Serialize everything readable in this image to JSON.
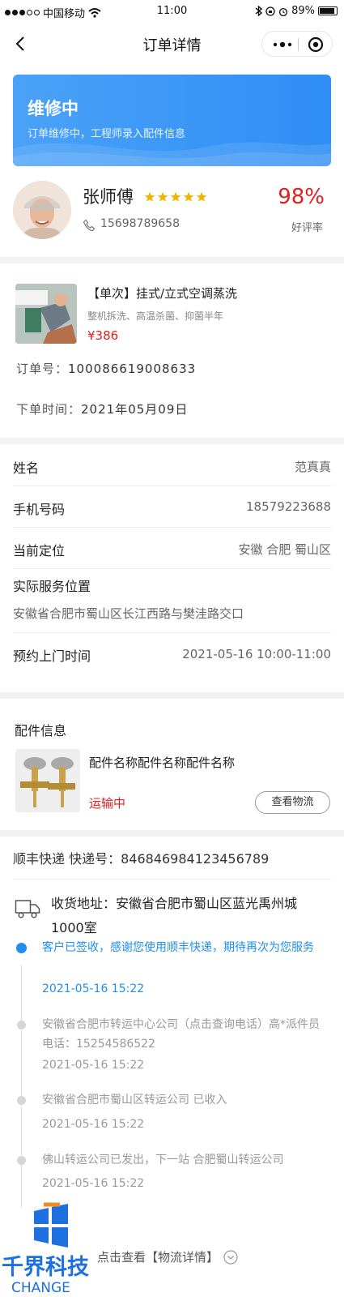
{
  "status_bar": {
    "carrier": "中国移动",
    "time": "11:00",
    "battery": "89%"
  },
  "nav": {
    "title": "订单详情",
    "more_icon": "more-dots-icon",
    "target_icon": "target-icon",
    "back_icon": "back-chevron-icon"
  },
  "banner": {
    "title": "维修中",
    "desc": "订单维修中，工程师录入配件信息",
    "colors": {
      "start": "#4aa2f8",
      "end": "#2f8ef5"
    }
  },
  "master": {
    "name": "张师傅",
    "stars": 5,
    "phone": "15698789658",
    "rate": "98%",
    "rate_label": "好评率"
  },
  "order": {
    "name": "【单次】挂式/立式空调蒸洗",
    "sub": "整机拆洗、高温杀菌、抑菌半年",
    "price": "¥386",
    "no_label": "订单号：",
    "no_value": "100086619008633",
    "time_label": "下单时间：",
    "time_value": "2021年05月09日"
  },
  "customer": {
    "name_label": "姓名",
    "name_value": "范真真",
    "phone_label": "手机号码",
    "phone_value": "18579223688",
    "location_label": "当前定位",
    "location_value": "安徽 合肥 蜀山区",
    "address_label": "实际服务位置",
    "address_value": "安徽省合肥市蜀山区长江西路与樊洼路交口",
    "appt_label": "预约上门时间",
    "appt_value": "2021-05-16 10:00-11:00"
  },
  "parts": {
    "title": "配件信息",
    "name": "配件名称配件名称配件名称",
    "status": "运输中",
    "button": "查看物流"
  },
  "shipping": {
    "header": "顺丰快递  快递号：846846984123456789",
    "receive": "收货地址：安徽省合肥市蜀山区蓝光禹州城1000室",
    "timeline": [
      {
        "text": "客户已签收，感谢您使用顺丰快递，期待再次为您服务",
        "time": "2021-05-16 15:22",
        "active": true
      },
      {
        "text": "安徽省合肥市转运中心公司（点击查询电话）高*派件员电话：15254586522",
        "time": "2021-05-16 15:22",
        "active": false
      },
      {
        "text": "安徽省合肥市蜀山区转运公司 已收入",
        "time": "2021-05-16 15:22",
        "active": false
      },
      {
        "text": "佛山转运公司已发出，下一站 合肥蜀山转运公司",
        "time": "2021-05-16 15:22",
        "active": false
      }
    ],
    "more": "点击查看【物流详情】"
  },
  "watermark": {
    "brand": "千界科技",
    "sub": "CHANGE"
  },
  "colors": {
    "accent_blue": "#1e8ef0",
    "price_red": "#e02020",
    "star_yellow": "#f5b400"
  }
}
